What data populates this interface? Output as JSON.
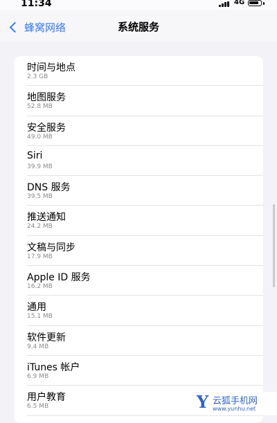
{
  "status_bar": {
    "time": "11:34",
    "network": "4G"
  },
  "nav": {
    "back_label": "蜂窝网络",
    "title": "系统服务"
  },
  "items": [
    {
      "title": "时间与地点",
      "size": "2.3 GB"
    },
    {
      "title": "地图服务",
      "size": "52.8 MB"
    },
    {
      "title": "安全服务",
      "size": "49.0 MB"
    },
    {
      "title": "Siri",
      "size": "39.9 MB"
    },
    {
      "title": "DNS 服务",
      "size": "39.5 MB"
    },
    {
      "title": "推送通知",
      "size": "24.2 MB"
    },
    {
      "title": "文稿与同步",
      "size": "17.9 MB"
    },
    {
      "title": "Apple ID 服务",
      "size": "16.2 MB"
    },
    {
      "title": "通用",
      "size": "15.1 MB"
    },
    {
      "title": "软件更新",
      "size": "9.4 MB"
    },
    {
      "title": "iTunes 帐户",
      "size": "6.9 MB"
    },
    {
      "title": "用户教育",
      "size": "6.5 MB"
    }
  ],
  "watermark": {
    "logo": "Y",
    "name": "云狐手机网",
    "url": "www.yunhu.net"
  },
  "colors": {
    "accent": "#3478f6",
    "background": "#f2f2f7",
    "secondary_text": "#8a8a8e",
    "watermark": "#2f63c8"
  }
}
